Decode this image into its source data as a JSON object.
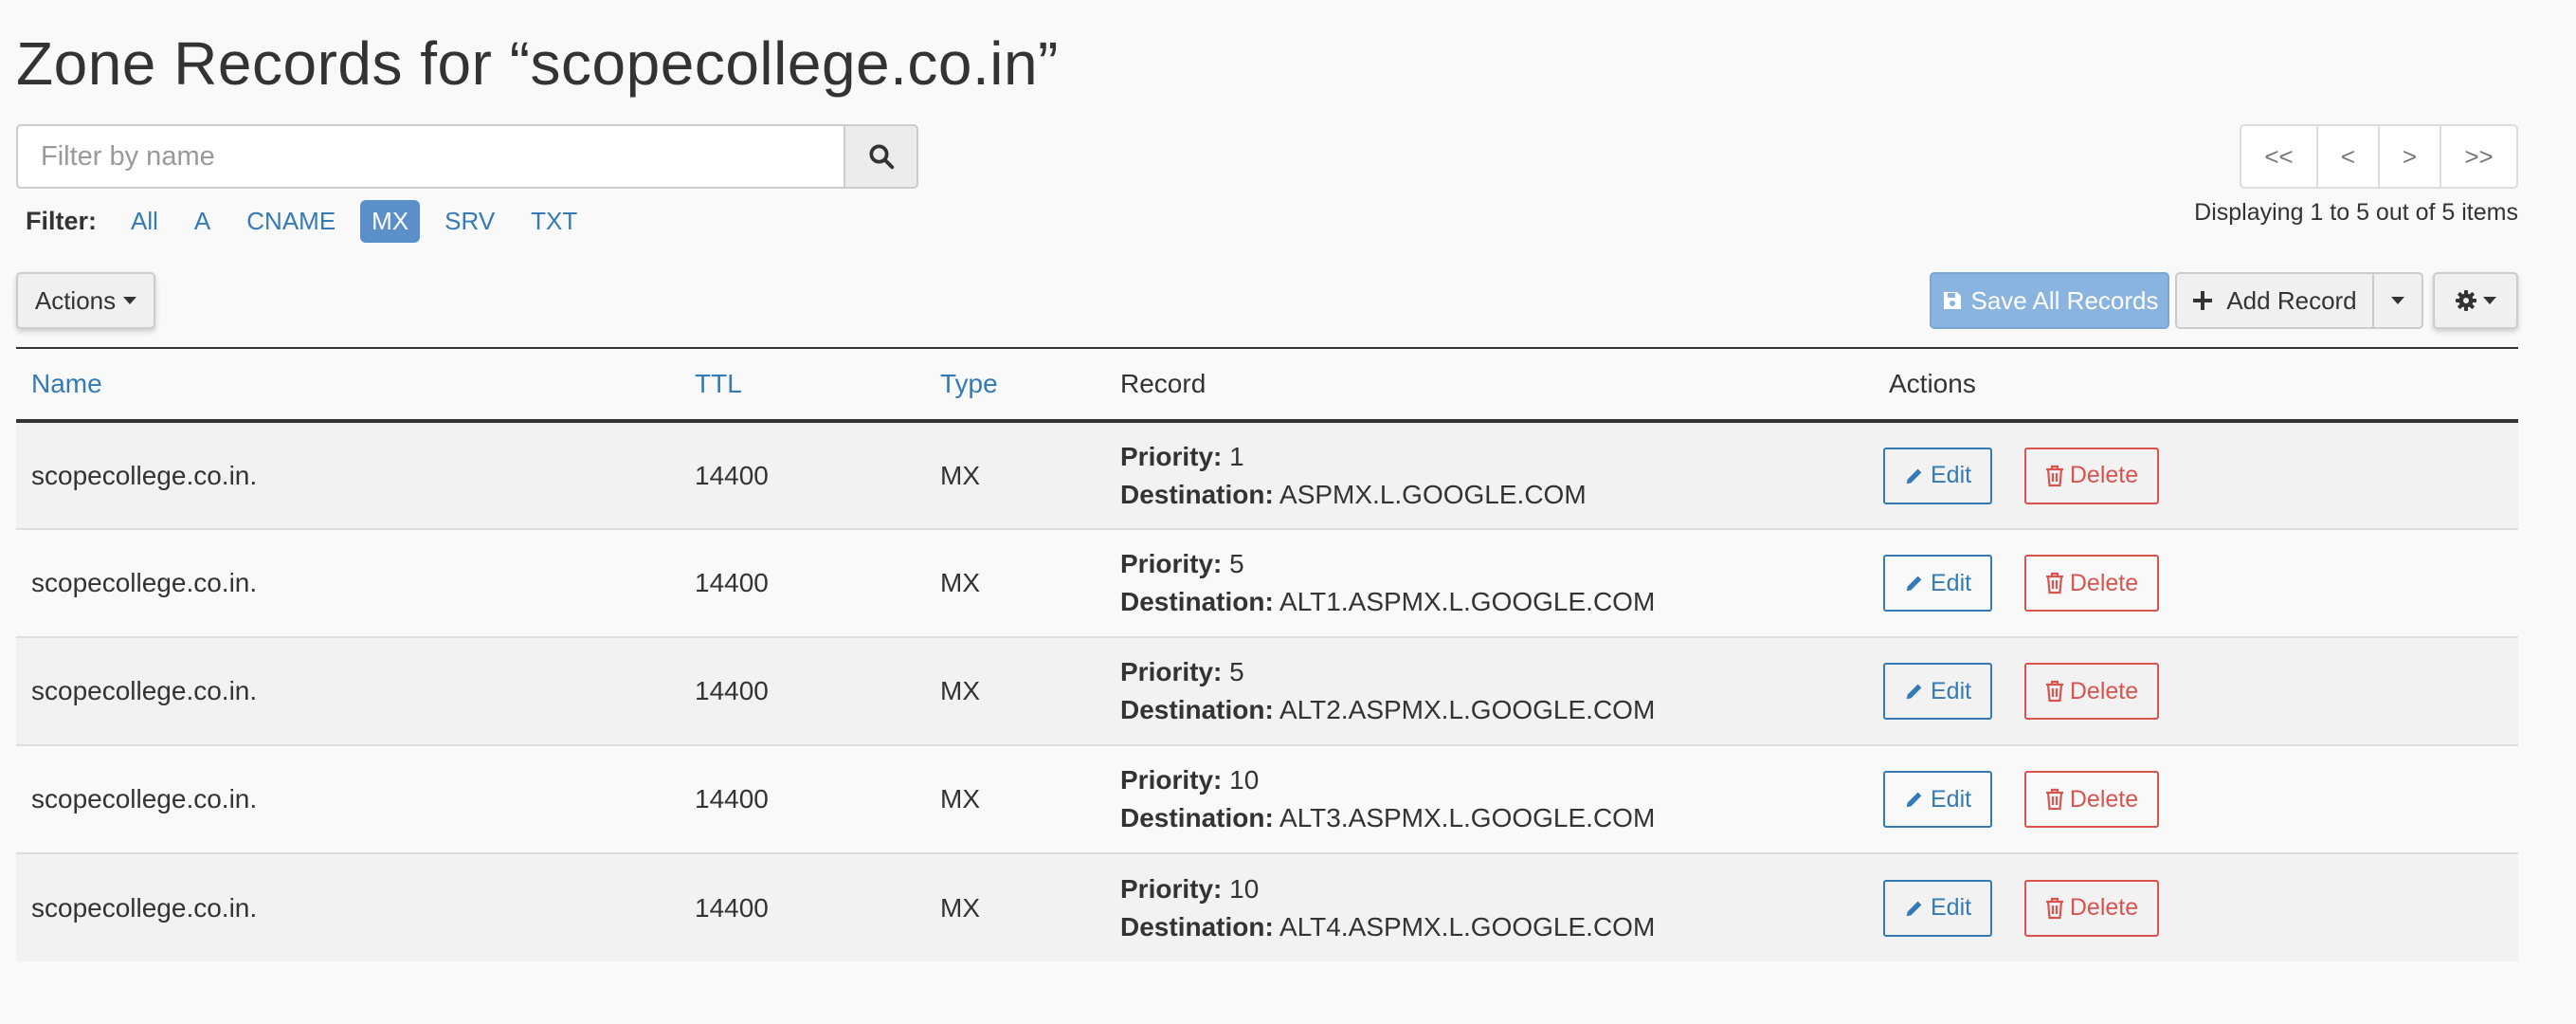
{
  "page_title": "Zone Records for “scopecollege.co.in”",
  "search": {
    "placeholder": "Filter by name",
    "value": ""
  },
  "filter": {
    "label": "Filter:",
    "options": [
      "All",
      "A",
      "CNAME",
      "MX",
      "SRV",
      "TXT"
    ],
    "active": "MX"
  },
  "pagination": {
    "first": "<<",
    "prev": "<",
    "next": ">",
    "last": ">>",
    "display_text": "Displaying 1 to 5 out of 5 items"
  },
  "toolbar": {
    "actions_label": "Actions",
    "save_all_label": "Save All Records",
    "add_record_label": "Add Record"
  },
  "table": {
    "headers": {
      "name": "Name",
      "ttl": "TTL",
      "type": "Type",
      "record": "Record",
      "actions": "Actions"
    },
    "labels": {
      "priority": "Priority:",
      "destination": "Destination:",
      "edit": "Edit",
      "delete": "Delete"
    },
    "rows": [
      {
        "name": "scopecollege.co.in.",
        "ttl": "14400",
        "type": "MX",
        "priority": "1",
        "destination": "ASPMX.L.GOOGLE.COM"
      },
      {
        "name": "scopecollege.co.in.",
        "ttl": "14400",
        "type": "MX",
        "priority": "5",
        "destination": "ALT1.ASPMX.L.GOOGLE.COM"
      },
      {
        "name": "scopecollege.co.in.",
        "ttl": "14400",
        "type": "MX",
        "priority": "5",
        "destination": "ALT2.ASPMX.L.GOOGLE.COM"
      },
      {
        "name": "scopecollege.co.in.",
        "ttl": "14400",
        "type": "MX",
        "priority": "10",
        "destination": "ALT3.ASPMX.L.GOOGLE.COM"
      },
      {
        "name": "scopecollege.co.in.",
        "ttl": "14400",
        "type": "MX",
        "priority": "10",
        "destination": "ALT4.ASPMX.L.GOOGLE.COM"
      }
    ]
  },
  "colors": {
    "link": "#337ab7",
    "active_filter": "#5b8fc9",
    "save_button": "#8ab4e0",
    "delete": "#d9534f"
  }
}
